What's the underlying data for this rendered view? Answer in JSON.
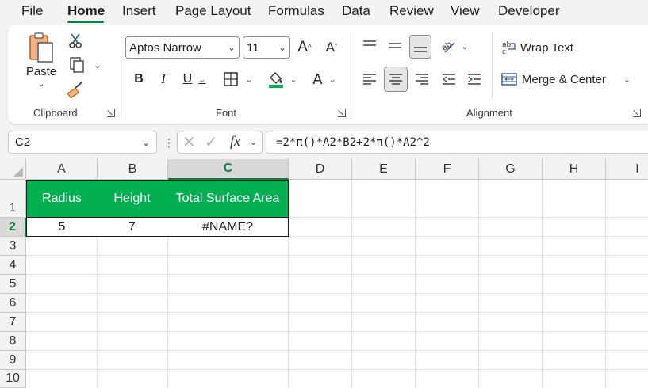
{
  "menu": {
    "tabs": [
      "File",
      "Home",
      "Insert",
      "Page Layout",
      "Formulas",
      "Data",
      "Review",
      "View",
      "Developer"
    ],
    "active_tab": "Home"
  },
  "ribbon": {
    "clipboard": {
      "label": "Clipboard",
      "paste_label": "Paste"
    },
    "font": {
      "label": "Font",
      "font_name": "Aptos Narrow",
      "font_size": "11",
      "bold": "B",
      "italic": "I",
      "underline": "U",
      "grow": "A",
      "shrink": "A",
      "font_color": "A"
    },
    "alignment": {
      "label": "Alignment",
      "wrap_text": "Wrap Text",
      "merge_center": "Merge & Center"
    },
    "accent_color": "#107c41",
    "fill_color": "#ffff00",
    "font_color": "#c00000"
  },
  "formula_bar": {
    "name_box": "C2",
    "fx": "fx",
    "formula": "=2*π()*A2*B2+2*π()*A2^2"
  },
  "sheet": {
    "columns": [
      "A",
      "B",
      "C",
      "D",
      "E",
      "F",
      "G",
      "H",
      "I"
    ],
    "rows": [
      "1",
      "2",
      "3",
      "4",
      "5",
      "6",
      "7",
      "8",
      "9",
      "10"
    ],
    "selected_column": "C",
    "selected_row": "2",
    "table_headers": [
      "Radius",
      "Height",
      "Total Surface Area"
    ],
    "table_values": [
      "5",
      "7",
      "#NAME?"
    ],
    "header_fill": "#00b050"
  }
}
